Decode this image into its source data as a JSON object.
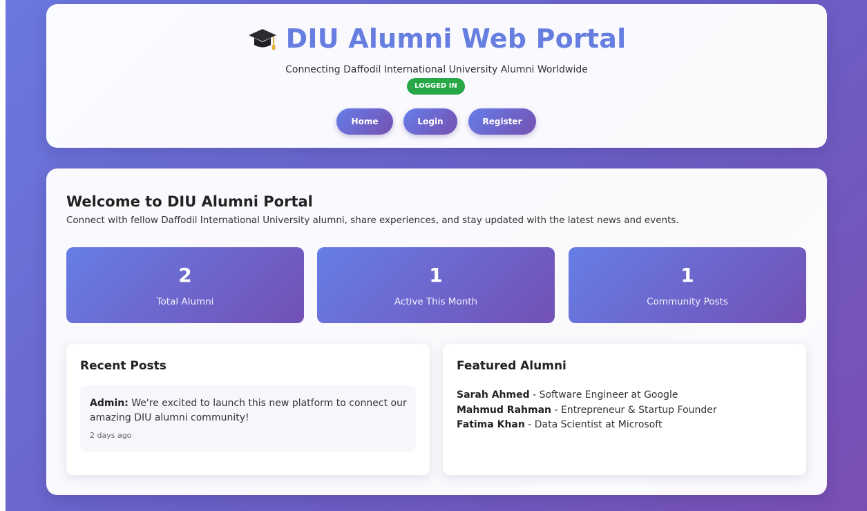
{
  "header": {
    "title": "DIU Alumni Web Portal",
    "icon": "graduation-cap-icon",
    "subtitle": "Connecting Daffodil International University Alumni Worldwide",
    "status_badge": "LOGGED IN",
    "nav": [
      {
        "label": "Home"
      },
      {
        "label": "Login"
      },
      {
        "label": "Register"
      }
    ]
  },
  "welcome": {
    "title": "Welcome to DIU Alumni Portal",
    "text": "Connect with fellow Daffodil International University alumni, share experiences, and stay updated with the latest news and events."
  },
  "stats": [
    {
      "value": "2",
      "label": "Total Alumni"
    },
    {
      "value": "1",
      "label": "Active This Month"
    },
    {
      "value": "1",
      "label": "Community Posts"
    }
  ],
  "recent_posts": {
    "title": "Recent Posts",
    "posts": [
      {
        "author": "Admin:",
        "text": "We're excited to launch this new platform to connect our amazing DIU alumni community!",
        "time": "2 days ago"
      }
    ]
  },
  "featured_alumni": {
    "title": "Featured Alumni",
    "items": [
      {
        "name": "Sarah Ahmed",
        "role": " - Software Engineer at Google"
      },
      {
        "name": "Mahmud Rahman",
        "role": " - Entrepreneur & Startup Founder"
      },
      {
        "name": "Fatima Khan",
        "role": " - Data Scientist at Microsoft"
      }
    ]
  },
  "colors": {
    "accent": "#667ee0",
    "badge_green": "#27a745",
    "gradient_start": "#667eea",
    "gradient_end": "#764ba2"
  }
}
